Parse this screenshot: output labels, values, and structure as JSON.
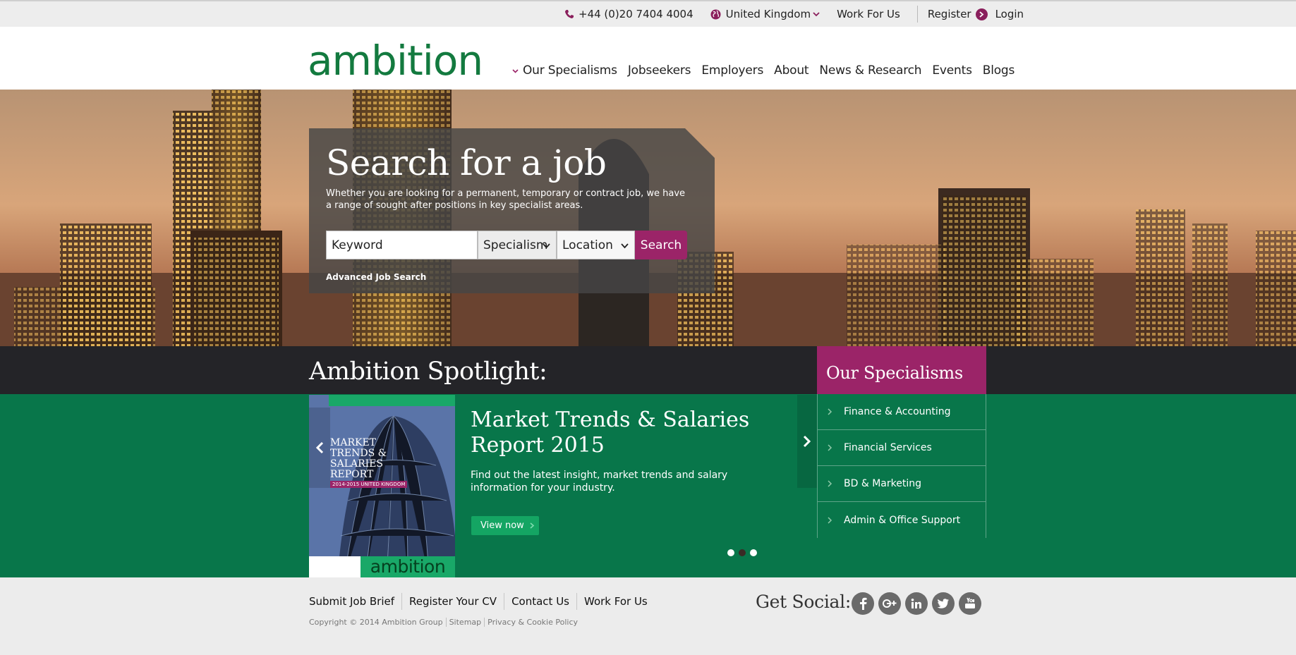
{
  "topbar": {
    "phone": "+44 (0)20 7404 4004",
    "country": "United Kingdom",
    "work_for_us": "Work For Us",
    "register": "Register",
    "login": "Login"
  },
  "header": {
    "logo": "ambition",
    "nav": [
      "Our Specialisms",
      "Jobseekers",
      "Employers",
      "About",
      "News & Research",
      "Events",
      "Blogs"
    ]
  },
  "search": {
    "title": "Search for a job",
    "description": "Whether you are looking for a permanent, temporary or contract job, we have a range of sought after positions in key specialist areas.",
    "keyword_value": "Keyword",
    "specialism_value": "Specialism",
    "location_value": "Location",
    "button": "Search",
    "advanced": "Advanced Job Search"
  },
  "spotlight": {
    "heading": "Ambition Spotlight:",
    "cover_text": "MARKET TRENDS & SALARIES REPORT",
    "cover_sub": "2014-2015 UNITED KINGDOM",
    "cover_logo": "ambition",
    "title": "Market Trends & Salaries Report 2015",
    "description": "Find out the latest insight, market trends and salary information for your industry.",
    "button": "View now",
    "slides": 3,
    "active_slide": 2
  },
  "specialisms": {
    "heading": "Our Specialisms",
    "items": [
      "Finance & Accounting",
      "Financial Services",
      "BD & Marketing",
      "Admin & Office Support"
    ]
  },
  "footer": {
    "links": [
      "Submit Job Brief",
      "Register Your CV",
      "Contact Us",
      "Work For Us"
    ],
    "copyright": [
      "Copyright © 2014 Ambition Group",
      "Sitemap",
      "Privacy & Cookie Policy"
    ],
    "social_label": "Get Social:",
    "social": [
      "facebook-icon",
      "google-plus-icon",
      "linkedin-icon",
      "twitter-icon",
      "youtube-icon"
    ]
  },
  "colors": {
    "brand_green": "#137a3f",
    "band_green": "#08764a",
    "accent_magenta": "#9b2468",
    "dark_band": "#242428"
  }
}
